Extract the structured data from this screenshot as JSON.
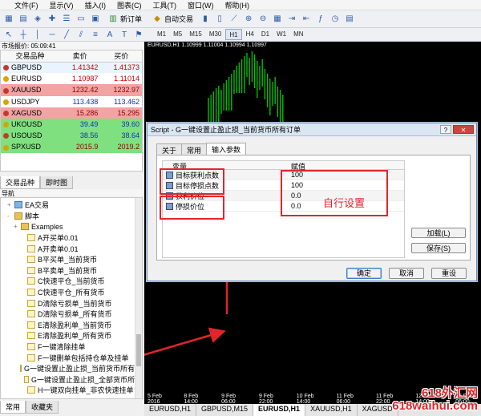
{
  "menu": [
    "文件(F)",
    "显示(V)",
    "插入(I)",
    "图表(C)",
    "工具(T)",
    "窗口(W)",
    "帮助(H)"
  ],
  "toolbar": {
    "new_order": "新订单",
    "auto_trade": "自动交易",
    "timeframes": [
      "M1",
      "M5",
      "M15",
      "M30",
      "H1",
      "H4",
      "D1",
      "W1",
      "MN"
    ],
    "active_timeframe": "H1"
  },
  "market_watch": {
    "title": "市场报价: 05:09:41",
    "headers": [
      "交易品种",
      "卖价",
      "买价"
    ],
    "rows": [
      {
        "symbol": "GBPUSD",
        "bid": "1.41342",
        "ask": "1.41373",
        "color": "#e8f4ff",
        "bidc": "#d00000",
        "askc": "#d00000"
      },
      {
        "symbol": "EURUSD",
        "bid": "1.10987",
        "ask": "1.11014",
        "color": "#ffffff",
        "bidc": "#d00000",
        "askc": "#d00000"
      },
      {
        "symbol": "XAUUSD",
        "bid": "1232.42",
        "ask": "1232.97",
        "color": "#f2a3a3",
        "bidc": "#8b0000",
        "askc": "#8b0000"
      },
      {
        "symbol": "USDJPY",
        "bid": "113.438",
        "ask": "113.462",
        "color": "#ffffff",
        "bidc": "#1030c0",
        "askc": "#1030c0"
      },
      {
        "symbol": "XAGUSD",
        "bid": "15.286",
        "ask": "15.295",
        "color": "#f2a3a3",
        "bidc": "#8b0000",
        "askc": "#8b0000"
      },
      {
        "symbol": "UKOUSD",
        "bid": "39.49",
        "ask": "39.60",
        "color": "#7fe07f",
        "bidc": "#1030c0",
        "askc": "#1030c0"
      },
      {
        "symbol": "USOUSD",
        "bid": "38.56",
        "ask": "38.64",
        "color": "#7fe07f",
        "bidc": "#1030c0",
        "askc": "#1030c0"
      },
      {
        "symbol": "SPXUSD",
        "bid": "2015.9",
        "ask": "2019.2",
        "color": "#7fe07f",
        "bidc": "#8b0000",
        "askc": "#8b0000"
      }
    ],
    "tabs": [
      "交易品种",
      "即时图"
    ]
  },
  "navigator": {
    "title": "导航",
    "items": [
      {
        "label": "EA交易",
        "indent": 1,
        "icon": "ea",
        "tree": "+"
      },
      {
        "label": "脚本",
        "indent": 1,
        "icon": "folder",
        "tree": "-"
      },
      {
        "label": "Examples",
        "indent": 2,
        "icon": "folder",
        "tree": "+"
      },
      {
        "label": "A开买单0.01",
        "indent": 3,
        "icon": "script",
        "tree": ""
      },
      {
        "label": "A开卖单0.01",
        "indent": 3,
        "icon": "script",
        "tree": ""
      },
      {
        "label": "B平买单_当前货币",
        "indent": 3,
        "icon": "script",
        "tree": ""
      },
      {
        "label": "B平卖单_当前货币",
        "indent": 3,
        "icon": "script",
        "tree": ""
      },
      {
        "label": "C快速平仓_当前货币",
        "indent": 3,
        "icon": "script",
        "tree": ""
      },
      {
        "label": "C快速平仓_所有货币",
        "indent": 3,
        "icon": "script",
        "tree": ""
      },
      {
        "label": "D清除亏损单_当前货币",
        "indent": 3,
        "icon": "script",
        "tree": ""
      },
      {
        "label": "D清除亏损单_所有货币",
        "indent": 3,
        "icon": "script",
        "tree": ""
      },
      {
        "label": "E清除盈利单_当前货币",
        "indent": 3,
        "icon": "script",
        "tree": ""
      },
      {
        "label": "E清除盈利单_所有货币",
        "indent": 3,
        "icon": "script",
        "tree": ""
      },
      {
        "label": "F一键清除挂单",
        "indent": 3,
        "icon": "script",
        "tree": ""
      },
      {
        "label": "F一键删单包括持仓单及挂单",
        "indent": 3,
        "icon": "script",
        "tree": ""
      },
      {
        "label": "G一键设置止盈止损_当前货币所有订",
        "indent": 3,
        "icon": "script",
        "tree": ""
      },
      {
        "label": "G一键设置止盈止损_全部货币所有",
        "indent": 3,
        "icon": "script",
        "tree": ""
      },
      {
        "label": "H一键双向挂单_非农快速挂单",
        "indent": 3,
        "icon": "script",
        "tree": ""
      }
    ],
    "tabs": [
      "常用",
      "收藏夹"
    ]
  },
  "chart": {
    "title": "EURUSD,H1  1.10999 1.11004 1.10994 1.10997",
    "dates": [
      "5 Feb 2016",
      "8 Feb 14:00",
      "9 Feb 06:00",
      "9 Feb 22:00",
      "10 Feb 14:00",
      "11 Feb 06:00",
      "11 Feb 22:00",
      "12 Feb 14:00",
      "15 Feb 06:00"
    ],
    "tabs": [
      "EURUSD,H1",
      "GBPUSD,M15",
      "EURUSD,H1",
      "XAUUSD,H1",
      "XAGUSD"
    ],
    "active_tab": 2
  },
  "dialog": {
    "title": "Script - G一键设置止盈止损_当前货币所有订单",
    "title_btns": [
      "?",
      "✕"
    ],
    "tabs": [
      "关于",
      "常用",
      "输入参数"
    ],
    "active_tab": 2,
    "col_var": "变量",
    "col_val": "赋值",
    "params": [
      {
        "name": "目标获利点数",
        "value": "100"
      },
      {
        "name": "目标停损点数",
        "value": "100"
      },
      {
        "name": "获利价位",
        "value": "0.0"
      },
      {
        "name": "停损价位",
        "value": "0.0"
      }
    ],
    "load": "加载(L)",
    "save": "保存(S)",
    "ok": "确定",
    "cancel": "取消",
    "reset": "重设"
  },
  "annotation": "自行设置",
  "watermark": [
    "618外汇网",
    "618waihui.com"
  ]
}
